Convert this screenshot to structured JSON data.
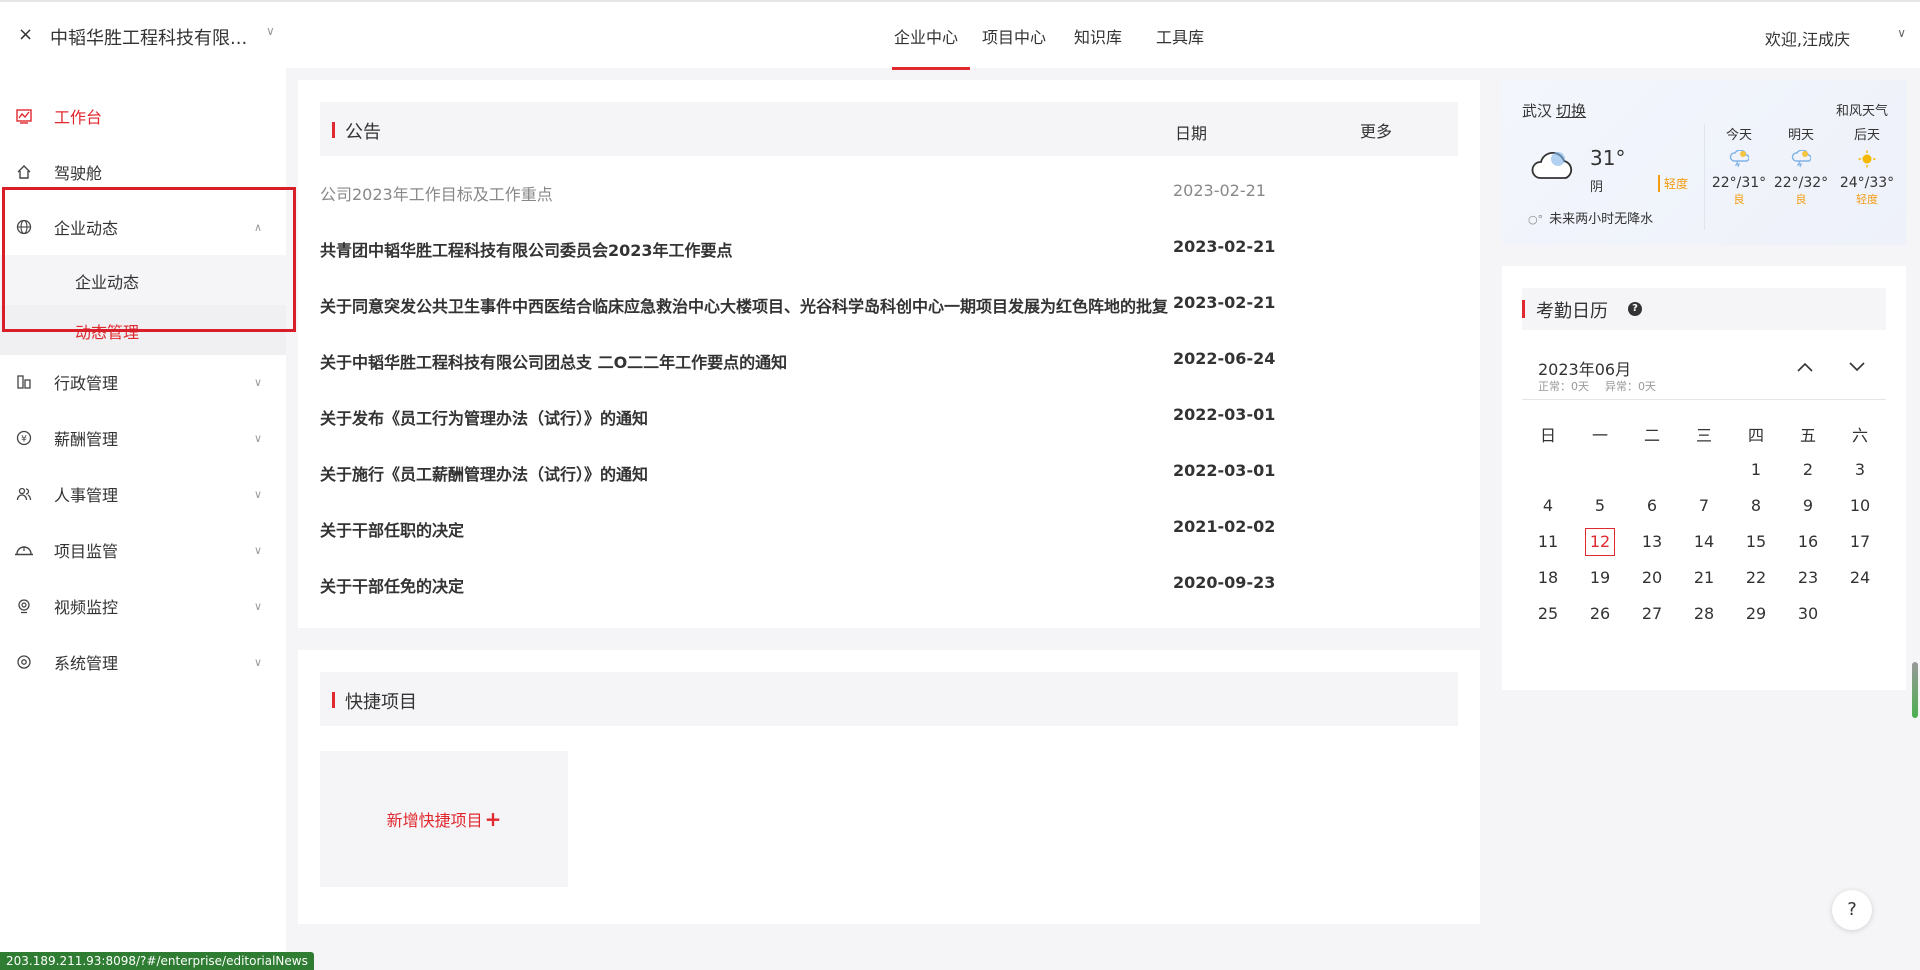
{
  "header": {
    "close_glyph": "×",
    "company": "中韬华胜工程科技有限...",
    "tabs": [
      {
        "label": "企业中心",
        "active": true
      },
      {
        "label": "项目中心",
        "active": false
      },
      {
        "label": "知识库",
        "active": false
      },
      {
        "label": "工具库",
        "active": false
      }
    ],
    "welcome": "欢迎,汪成庆"
  },
  "sidebar": {
    "items": [
      {
        "label": "工作台",
        "icon": "chart-line-icon",
        "active": true
      },
      {
        "label": "驾驶舱",
        "icon": "home-icon"
      },
      {
        "label": "企业动态",
        "icon": "globe-icon",
        "expanded": true
      },
      {
        "label": "行政管理",
        "icon": "building-icon"
      },
      {
        "label": "薪酬管理",
        "icon": "salary-icon"
      },
      {
        "label": "人事管理",
        "icon": "people-icon"
      },
      {
        "label": "项目监管",
        "icon": "helmet-icon"
      },
      {
        "label": "视频监控",
        "icon": "camera-icon"
      },
      {
        "label": "系统管理",
        "icon": "settings-icon"
      }
    ],
    "sub_items": [
      {
        "label": "企业动态"
      },
      {
        "label": "动态管理",
        "active": true
      }
    ]
  },
  "announcements": {
    "title": "公告",
    "date_header": "日期",
    "more": "更多",
    "rows": [
      {
        "title": "公司2023年工作目标及工作重点",
        "date": "2023-02-21"
      },
      {
        "title": "共青团中韬华胜工程科技有限公司委员会2023年工作要点",
        "date": "2023-02-21"
      },
      {
        "title": "关于同意突发公共卫生事件中西医结合临床应急救治中心大楼项目、光谷科学岛科创中心一期项目发展为红色阵地的批复",
        "date": "2023-02-21"
      },
      {
        "title": "关于中韬华胜工程科技有限公司团总支 二O二二年工作要点的通知",
        "date": "2022-06-24"
      },
      {
        "title": "关于发布《员工行为管理办法（试行）》的通知",
        "date": "2022-03-01"
      },
      {
        "title": "关于施行《员工薪酬管理办法（试行）》的通知",
        "date": "2022-03-01"
      },
      {
        "title": "关于干部任职的决定",
        "date": "2021-02-02"
      },
      {
        "title": "关于干部任免的决定",
        "date": "2020-09-23"
      }
    ]
  },
  "quick_projects": {
    "title": "快捷项目",
    "add_label": "新增快捷项目",
    "add_plus": "+"
  },
  "weather": {
    "city": "武汉",
    "switch": "切换",
    "brand": "和风天气",
    "temp": "31°",
    "condition": "阴",
    "aqi": "轻度",
    "rain": "未来两小时无降水",
    "forecast": [
      {
        "day": "今天",
        "range": "22°/31°",
        "quality": "良"
      },
      {
        "day": "明天",
        "range": "22°/32°",
        "quality": "良"
      },
      {
        "day": "后天",
        "range": "24°/33°",
        "quality": "轻度"
      }
    ]
  },
  "calendar": {
    "title": "考勤日历",
    "help": "?",
    "month": "2023年06月",
    "normal": "正常：0天",
    "abnormal": "异常：0天",
    "weekdays": [
      "日",
      "一",
      "二",
      "三",
      "四",
      "五",
      "六"
    ],
    "weeks": [
      [
        "",
        "",
        "",
        "",
        "1",
        "2",
        "3"
      ],
      [
        "4",
        "5",
        "6",
        "7",
        "8",
        "9",
        "10"
      ],
      [
        "11",
        "12",
        "13",
        "14",
        "15",
        "16",
        "17"
      ],
      [
        "18",
        "19",
        "20",
        "21",
        "22",
        "23",
        "24"
      ],
      [
        "25",
        "26",
        "27",
        "28",
        "29",
        "30",
        ""
      ]
    ],
    "today": "12"
  },
  "status_url": "203.189.211.93:8098/?#/enterprise/editorialNews",
  "help_fab": "?",
  "colors": {
    "accent": "#e0282f",
    "aqi": "#f39c12"
  }
}
